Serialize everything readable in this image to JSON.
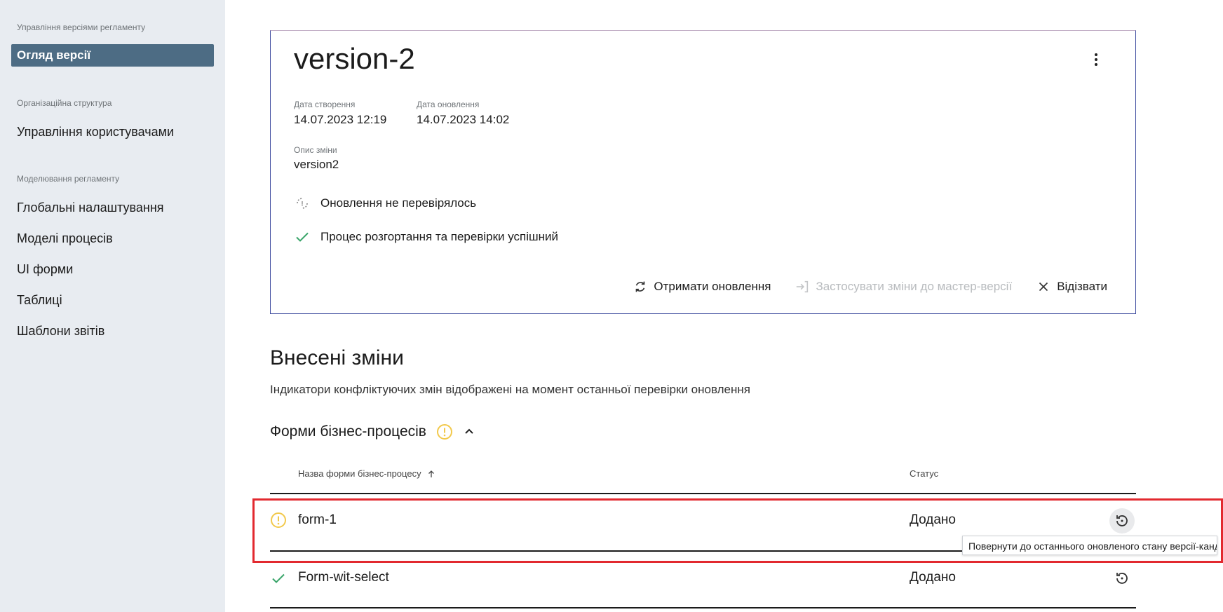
{
  "sidebar": {
    "group1": "Управління версіями регламенту",
    "active_item": "Огляд версії",
    "group2": "Організаційна структура",
    "item_users": "Управління користувачами",
    "group3": "Моделювання регламенту",
    "items": [
      "Глобальні налаштування",
      "Моделі процесів",
      "UI форми",
      "Таблиці",
      "Шаблони звітів"
    ]
  },
  "card": {
    "title": "version-2",
    "created_label": "Дата створення",
    "created_value": "14.07.2023 12:19",
    "updated_label": "Дата оновлення",
    "updated_value": "14.07.2023 14:02",
    "desc_label": "Опис зміни",
    "desc_value": "version2",
    "status_update": "Оновлення не перевірялось",
    "status_deploy": "Процес розгортання та перевірки успішний",
    "actions": {
      "get_updates": "Отримати оновлення",
      "apply_changes": "Застосувати зміни до мастер-версії",
      "revoke": "Відізвати"
    }
  },
  "changes": {
    "title": "Внесені зміни",
    "subtitle": "Індикатори конфліктуючих змін відображені на момент останньої перевірки оновлення",
    "group_title": "Форми бізнес-процесів",
    "col_name": "Назва форми бізнес-процесу",
    "col_status": "Статус",
    "rows": [
      {
        "name": "form-1",
        "status": "Додано",
        "indicator": "warning"
      },
      {
        "name": "Form-wit-select",
        "status": "Додано",
        "indicator": "success"
      }
    ],
    "tooltip": "Повернути до останнього оновленого стану версії-кандидата"
  },
  "colors": {
    "accent": "#4d6c84",
    "warning": "#f2c94c",
    "success": "#3aa56a",
    "highlight": "#e2292f"
  }
}
